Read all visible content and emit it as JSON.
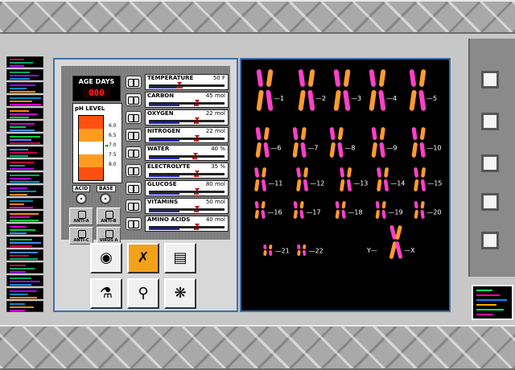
{
  "age": {
    "label": "AGE DAYS",
    "value": "000"
  },
  "ph": {
    "label": "pH LEVEL",
    "values": [
      "6.0",
      "6.5",
      "7.0",
      "7.5",
      "8.0"
    ],
    "colors": [
      "#ff5010",
      "#ff9c20",
      "#ffffff",
      "#ff9c20",
      "#ff5010"
    ]
  },
  "acid_label": "ACID",
  "base_label": "BASE",
  "anti": {
    "a": "ANTI-A",
    "b": "ANTI-B",
    "c": "ANTI-C",
    "virus": "VIRUS A"
  },
  "meters": [
    {
      "name": "TEMPERATURE",
      "value": "50 F"
    },
    {
      "name": "CARBON",
      "value": "45 mol"
    },
    {
      "name": "OXYGEN",
      "value": "22 mol"
    },
    {
      "name": "NITROGEN",
      "value": "22 mol"
    },
    {
      "name": "WATER",
      "value": "40 %"
    },
    {
      "name": "ELECTROLYTE",
      "value": "35 %"
    },
    {
      "name": "GLUCOSE",
      "value": "80 mol"
    },
    {
      "name": "VITAMINS",
      "value": "50 mol"
    },
    {
      "name": "AMINO ACIDS",
      "value": "40 mol"
    }
  ],
  "tools": [
    {
      "icon": "cell-icon"
    },
    {
      "icon": "chromosome-icon"
    },
    {
      "icon": "dna-sequence-icon"
    },
    {
      "icon": "test-tube-icon"
    },
    {
      "icon": "microscope-icon"
    },
    {
      "icon": "bacteria-icon"
    }
  ],
  "chromosomes": [
    "1",
    "2",
    "3",
    "4",
    "5",
    "6",
    "7",
    "8",
    "9",
    "10",
    "11",
    "12",
    "13",
    "14",
    "15",
    "16",
    "17",
    "18",
    "19",
    "20",
    "21",
    "22"
  ],
  "sex_chromosomes": {
    "y": "Y",
    "x": "X"
  },
  "colors": {
    "chromosome_a": "#ff40c8",
    "chromosome_b": "#ff9a30",
    "panel_border": "#3e6fa8"
  }
}
